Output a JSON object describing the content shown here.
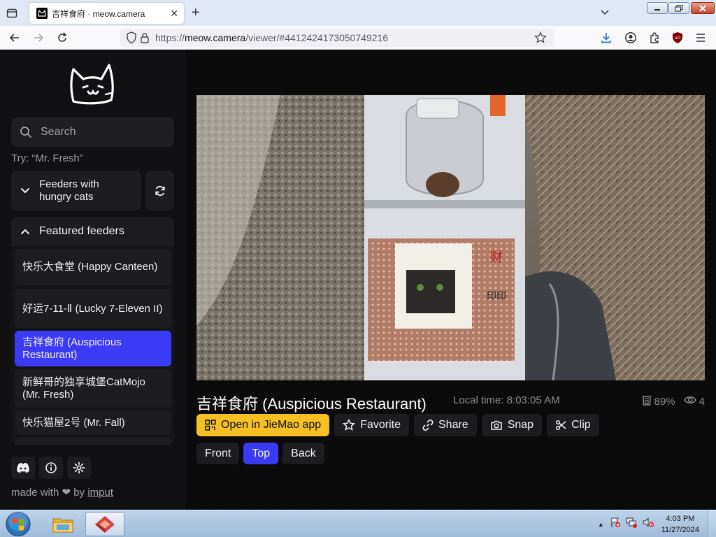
{
  "browser": {
    "tab_title": "吉祥食府 · meow.camera",
    "url_prefix": "https://",
    "url_host": "meow.camera",
    "url_path": "/viewer/#4412424173050749216"
  },
  "sidebar": {
    "search_placeholder": "Search",
    "try_hint": "Try: “Mr. Fresh”",
    "group_hungry": "Feeders with hungry cats",
    "group_featured": "Featured feeders",
    "feeders": [
      {
        "label": "快乐大食堂 (Happy Canteen)",
        "active": false
      },
      {
        "label": "好运7-11-Ⅱ (Lucky 7-Eleven II)",
        "active": false
      },
      {
        "label": "吉祥食府 (Auspicious Restaurant)",
        "active": true
      },
      {
        "label": "新鲜哥的独享城堡CatMojo (Mr. Fresh)",
        "active": false
      },
      {
        "label": "快乐猫屋2号 (Mr. Fall)",
        "active": false
      }
    ],
    "made_with": "made with",
    "by": "by",
    "author": "imput"
  },
  "viewer": {
    "title": "吉祥食府 (Auspicious Restaurant)",
    "local_time": "Local time: 8:03:05 AM",
    "food_level": "89%",
    "viewers": "4",
    "actions": {
      "open_app": "Open in JieMao app",
      "favorite": "Favorite",
      "share": "Share",
      "snap": "Snap",
      "clip": "Clip"
    },
    "views": [
      "Front",
      "Top",
      "Back"
    ],
    "active_view": "Top"
  },
  "taskbar": {
    "time": "4:03 PM",
    "date": "11/27/2024"
  },
  "colors": {
    "accent": "#3b3bf5",
    "primary_button": "#f5c024"
  }
}
